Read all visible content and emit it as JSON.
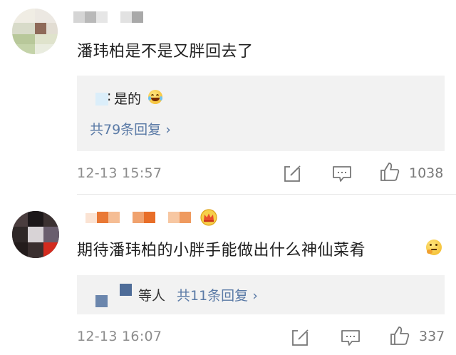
{
  "comments": [
    {
      "text": "潘玮柏是不是又胖回去了",
      "reply_preview": "是的",
      "reply_link": "共79条回复 ›",
      "timestamp": "12-13 15:57",
      "like_count": "1038"
    },
    {
      "text": "期待潘玮柏的小胖手能做出什么神仙菜肴",
      "reply_preview": "等人",
      "reply_link": "共11条回复 ›",
      "timestamp": "12-13 16:07",
      "like_count": "337"
    }
  ],
  "icons": [
    "avatar",
    "edit-icon",
    "comment-icon",
    "like-icon",
    "crown-badge-icon",
    "laughing-emoji-icon",
    "thinking-emoji-icon"
  ],
  "colors": {
    "link": "#5a7aa6",
    "meta": "#8c8c8c",
    "reply_bg": "#f2f2f2",
    "badge": "#e8b321"
  }
}
